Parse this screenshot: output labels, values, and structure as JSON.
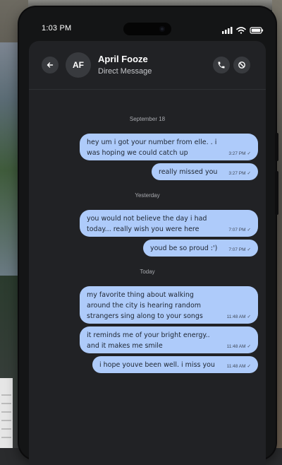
{
  "status_bar": {
    "time": "1:03 PM"
  },
  "header": {
    "avatar_initials": "AF",
    "contact_name": "April Fooze",
    "subtitle": "Direct Message"
  },
  "conversation": {
    "groups": [
      {
        "date_label": "September 18",
        "messages": [
          {
            "text_lines": [
              "hey um i got your number from elle. . i",
              "was hoping we could catch up"
            ],
            "time": "3:27 PM"
          },
          {
            "text_lines": [
              "really missed you"
            ],
            "time": "3:27 PM"
          }
        ]
      },
      {
        "date_label": "Yesterday",
        "messages": [
          {
            "text_lines": [
              "you would not believe the day i had",
              "today... really wish you were here"
            ],
            "time": "7:07 PM"
          },
          {
            "text_lines": [
              "youd be so proud :')"
            ],
            "time": "7:07 PM"
          }
        ]
      },
      {
        "date_label": "Today",
        "messages": [
          {
            "text_lines": [
              "my favorite thing about walking",
              "around the city is hearing random",
              "strangers sing along to your songs"
            ],
            "time": "11:48 AM"
          },
          {
            "text_lines": [
              "it reminds me of your bright energy..",
              "and it makes me smile"
            ],
            "time": "11:48 AM"
          },
          {
            "text_lines": [
              "i hope youve been well. i miss you"
            ],
            "time": "11:48 AM"
          }
        ]
      }
    ]
  },
  "colors": {
    "bubble": "#aecbfa",
    "screen_bg": "#212225",
    "header_button_bg": "#383a3e"
  },
  "icons": {
    "back": "arrow-left-icon",
    "call": "phone-icon",
    "block": "block-icon",
    "read_receipt": "check-icon"
  }
}
